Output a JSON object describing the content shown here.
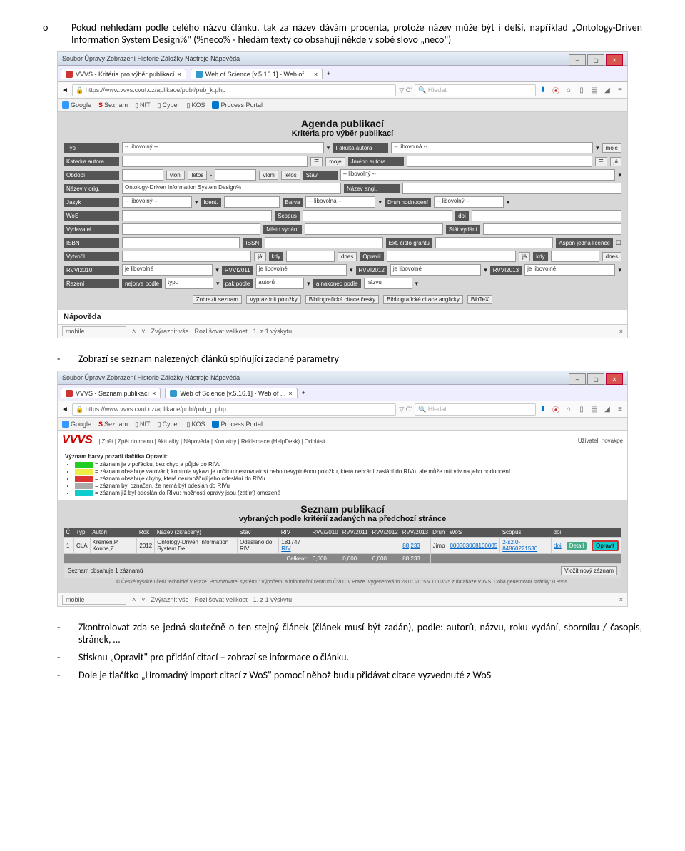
{
  "para_o": "Pokud nehledám podle celého názvu článku, tak za název dávám procenta, protože název může být i delší, například „Ontology-Driven Information System Design%\" (%neco% - hledám texty co obsahují někde v sobě slovo „neco\")",
  "para_dash1": "Zobrazí se seznam nalezených článků splňující zadané parametry",
  "para_dash2": "Zkontrolovat zda se jedná skutečně o ten stejný článek (článek musí být zadán), podle: autorů, názvu, roku vydání, sborníku / časopis, stránek, …",
  "para_dash3": "Stisknu „Opravit\" pro přidání citací – zobrazí se informace o článku.",
  "para_dash4": "Dole je tlačítko „Hromadný import citací z WoS\" pomocí něhož budu přidávat citace vyzvednuté z WoS",
  "s1": {
    "menu": "Soubor  Úpravy  Zobrazení  Historie  Záložky  Nástroje  Nápověda",
    "tab1": "VVVS - Kritéria pro výběr publikací",
    "tab2": "Web of Science [v.5.16.1] - Web of ...",
    "url": "https://www.vvvs.cvut.cz/aplikace/publ/pub_k.php",
    "search_ph": "Hledat",
    "bookmarks": [
      "Google",
      "Seznam",
      "NIT",
      "Cyber",
      "KOS",
      "Process Portal"
    ],
    "title": "Agenda publikací",
    "subtitle": "Kritéria pro výběr publikací",
    "labels": {
      "typ": "Typ",
      "fakulta": "Fakulta autora",
      "moje": "moje",
      "katedra": "Katedra autora",
      "jmeno": "Jméno autora",
      "ja": "já",
      "obdobi": "Období",
      "vloni": "vloni",
      "letos": "letos",
      "stav": "Stav",
      "nazevorig": "Název v orig.",
      "nazevangl": "Název angl.",
      "jazyk": "Jazyk",
      "ident": "Ident.",
      "barva": "Barva",
      "druh": "Druh hodnocení",
      "wos": "WoS",
      "scopus": "Scopus",
      "doi": "doi",
      "vydavatel": "Vydavatel",
      "misto": "Místo vydání",
      "statv": "Stát vydání",
      "isbn": "ISBN",
      "issn": "ISSN",
      "ext": "Ext. číslo grantu",
      "aspon": "Aspoň jedna licence",
      "vytvoril": "Vytvořil",
      "kdy": "kdy",
      "dnes": "dnes",
      "opravil": "Opravil",
      "rvvi10": "RVVI2010",
      "rvvi11": "RVVI2011",
      "rvvi12": "RVVI2012",
      "rvvi13": "RVVI2013",
      "razeni": "Řazení",
      "nejprve": "nejprve podle",
      "typu": "typu",
      "pakpodle": "pak podle",
      "autoru": "autorů",
      "anakonec": "a nakonec podle",
      "nazvu": "názvu"
    },
    "values": {
      "libovolny": "-- libovolný --",
      "libovolna": "-- libovolná --",
      "nazev": "Ontology-Driven Information System Design%",
      "jelibovolne": "je libovolné"
    },
    "buttons": [
      "Zobrazit seznam",
      "Vyprázdnit položky",
      "Bibliografické citace česky",
      "Bibliografické citace anglicky",
      "BibTeX"
    ],
    "napoveda": "Nápověda",
    "find": {
      "val": "mobile",
      "zv": "Zvýraznit vše",
      "roz": "Rozlišovat velikost",
      "res": "1. z 1 výskytu"
    }
  },
  "s2": {
    "menu": "Soubor  Úpravy  Zobrazení  Historie  Záložky  Nástroje  Nápověda",
    "tab1": "VVVS - Seznam publikací",
    "tab2": "Web of Science [v.5.16.1] - Web of ...",
    "url": "https://www.vvvs.cvut.cz/aplikace/publ/pub_p.php",
    "search_ph": "Hledat",
    "bookmarks": [
      "Google",
      "Seznam",
      "NIT",
      "Cyber",
      "KOS",
      "Process Portal"
    ],
    "logo": "VVVS",
    "nav": "| Zpět | Zpět do menu | Aktuality | Nápověda | Kontakty | Reklamace (HelpDesk) | Odhlásit |",
    "user": "Uživatel: novakpe",
    "legend_title": "Význam barvy pozadí tlačítka Opravit:",
    "legend": [
      {
        "color": "#2c2",
        "text": "= záznam je v pořádku, bez chyb a půjde do RIVu"
      },
      {
        "color": "#ee4",
        "text": "= záznam obsahuje varování; kontrola vykazuje určitou nesrovnalost nebo nevyplněnou položku, která nebrání zaslání do RIVu, ale může mít vliv na jeho hodnocení"
      },
      {
        "color": "#d33",
        "text": "= záznam obsahuje chyby, které neumožňují jeho odeslání do RIVu"
      },
      {
        "color": "#aaa",
        "text": "= záznam byl označen, že nemá být odeslán do RIVu"
      },
      {
        "color": "#1cc",
        "text": "= záznam již byl odeslán do RIVu; možnosti opravy jsou (zatím) omezené"
      }
    ],
    "list_title": "Seznam publikací",
    "list_sub": "vybraných podle kritérií zadaných na předchozí stránce",
    "cols": [
      "Č.",
      "Typ",
      "Autoři",
      "Rok",
      "Název (zkrácený)",
      "Stav",
      "RIV",
      "RVV/2010",
      "RVV/2011",
      "RVV/2012",
      "RVV/2013",
      "Druh",
      "WoS",
      "Scopus",
      "doi",
      "",
      ""
    ],
    "row": {
      "c": "1",
      "typ": "CLA",
      "aut": "Křemen,P. Kouba,Z.",
      "rok": "2012",
      "naz": "Ontology-Driven Information System De...",
      "stav": "Odesláno do RIV",
      "riv": "181747",
      "riv_l": "RIV",
      "r10": "",
      "r11": "",
      "r12": "",
      "r13": "88,233",
      "druh": "Jimp",
      "wos": "000303068100005",
      "scopus": "2-s2.0-84860221530",
      "doi": "doi",
      "detail": "Detail",
      "opravit": "Opravit"
    },
    "sum": {
      "label": "Celkem:",
      "v1": "0,000",
      "v2": "0,000",
      "v3": "0,000",
      "v4": "88,233"
    },
    "count": "Seznam obsahuje 1 záznamů",
    "vlozit": "Vložit nový záznam",
    "gen": "© České vysoké učení technické v Praze. Provozovatel systému: Výpočetní a informační centrum ČVUT v Praze. Vygenerováno 28.01.2015 v 11:03:25 z databáze VVVS. Doba generování stránky: 0.855s.",
    "find": {
      "val": "mobile",
      "zv": "Zvýraznit vše",
      "roz": "Rozlišovat velikost",
      "res": "1. z 1 výskytu"
    }
  }
}
